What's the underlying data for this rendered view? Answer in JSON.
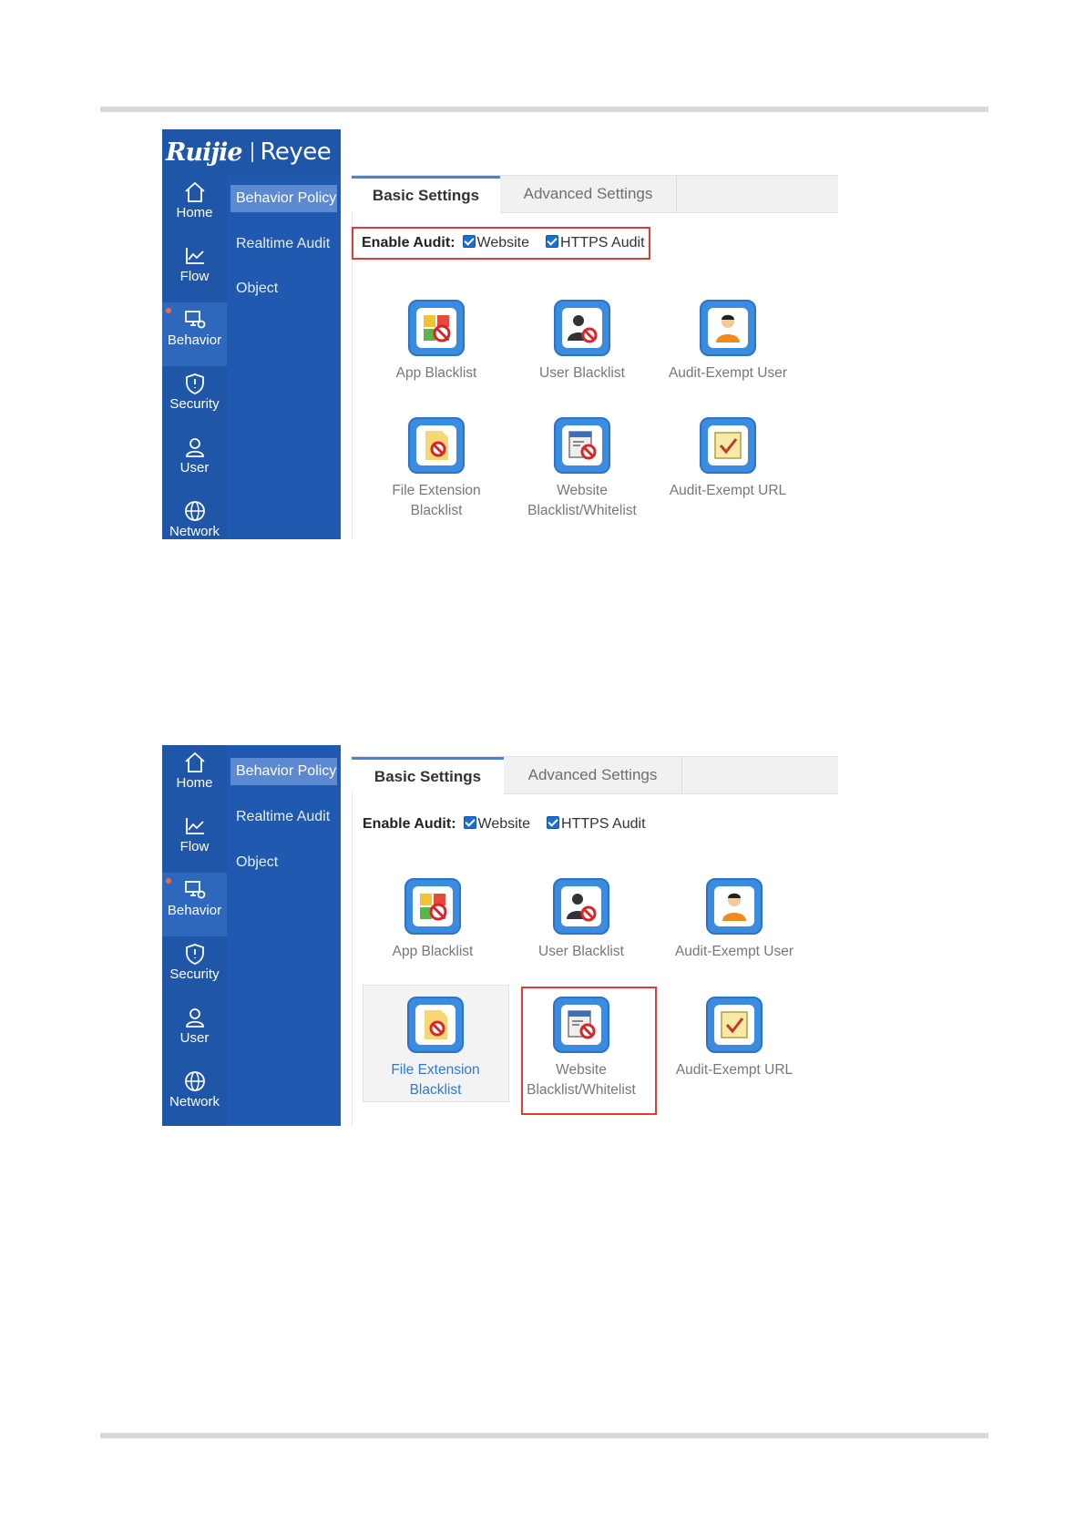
{
  "screens": [
    {
      "logo": {
        "brand1": "Ruijie",
        "brand2": "Reyee"
      },
      "nav": [
        {
          "label": "Home",
          "icon": "home-icon"
        },
        {
          "label": "Flow",
          "icon": "chart-line-icon"
        },
        {
          "label": "Behavior",
          "icon": "monitor-gear-icon",
          "active": true
        },
        {
          "label": "Security",
          "icon": "shield-icon"
        },
        {
          "label": "User",
          "icon": "user-icon"
        },
        {
          "label": "Network",
          "icon": "globe-icon"
        }
      ],
      "submenu": [
        {
          "label": "Behavior Policy",
          "active": true
        },
        {
          "label": "Realtime Audit"
        },
        {
          "label": "Object"
        }
      ],
      "tabs": [
        {
          "label": "Basic Settings",
          "active": true
        },
        {
          "label": "Advanced Settings"
        }
      ],
      "audit": {
        "label": "Enable Audit:",
        "website": "Website",
        "https": "HTTPS Audit",
        "website_checked": true,
        "https_checked": true
      },
      "tiles": [
        {
          "line1": "App Blacklist",
          "line2": "",
          "icon": "app-blacklist-icon"
        },
        {
          "line1": "User Blacklist",
          "line2": "",
          "icon": "user-blacklist-icon"
        },
        {
          "line1": "Audit-Exempt User",
          "line2": "",
          "icon": "audit-exempt-user-icon"
        },
        {
          "line1": "File Extension",
          "line2": "Blacklist",
          "icon": "file-extension-blacklist-icon"
        },
        {
          "line1": "Website",
          "line2": "Blacklist/Whitelist",
          "icon": "website-blacklist-icon"
        },
        {
          "line1": "Audit-Exempt URL",
          "line2": "",
          "icon": "audit-exempt-url-icon"
        }
      ]
    },
    {
      "nav": [
        {
          "label": "Home",
          "icon": "home-icon"
        },
        {
          "label": "Flow",
          "icon": "chart-line-icon"
        },
        {
          "label": "Behavior",
          "icon": "monitor-gear-icon",
          "active": true
        },
        {
          "label": "Security",
          "icon": "shield-icon"
        },
        {
          "label": "User",
          "icon": "user-icon"
        },
        {
          "label": "Network",
          "icon": "globe-icon"
        }
      ],
      "submenu": [
        {
          "label": "Behavior Policy",
          "active": true
        },
        {
          "label": "Realtime Audit"
        },
        {
          "label": "Object"
        }
      ],
      "tabs": [
        {
          "label": "Basic Settings",
          "active": true
        },
        {
          "label": "Advanced Settings"
        }
      ],
      "audit": {
        "label": "Enable Audit:",
        "website": "Website",
        "https": "HTTPS Audit",
        "website_checked": true,
        "https_checked": true
      },
      "tiles": [
        {
          "line1": "App Blacklist",
          "line2": "",
          "icon": "app-blacklist-icon"
        },
        {
          "line1": "User Blacklist",
          "line2": "",
          "icon": "user-blacklist-icon"
        },
        {
          "line1": "Audit-Exempt User",
          "line2": "",
          "icon": "audit-exempt-user-icon"
        },
        {
          "line1": "File Extension",
          "line2": "Blacklist",
          "icon": "file-extension-blacklist-icon",
          "hovered": true
        },
        {
          "line1": "Website",
          "line2": "Blacklist/Whitelist",
          "icon": "website-blacklist-icon",
          "highlighted": true
        },
        {
          "line1": "Audit-Exempt URL",
          "line2": "",
          "icon": "audit-exempt-url-icon"
        }
      ]
    }
  ],
  "colors": {
    "sidebar": "#1f56a8",
    "submenu": "#2059b0",
    "active_sub": "#5c89cf",
    "tile_blue": "#3b8be0",
    "highlight_red": "#e03c31"
  }
}
